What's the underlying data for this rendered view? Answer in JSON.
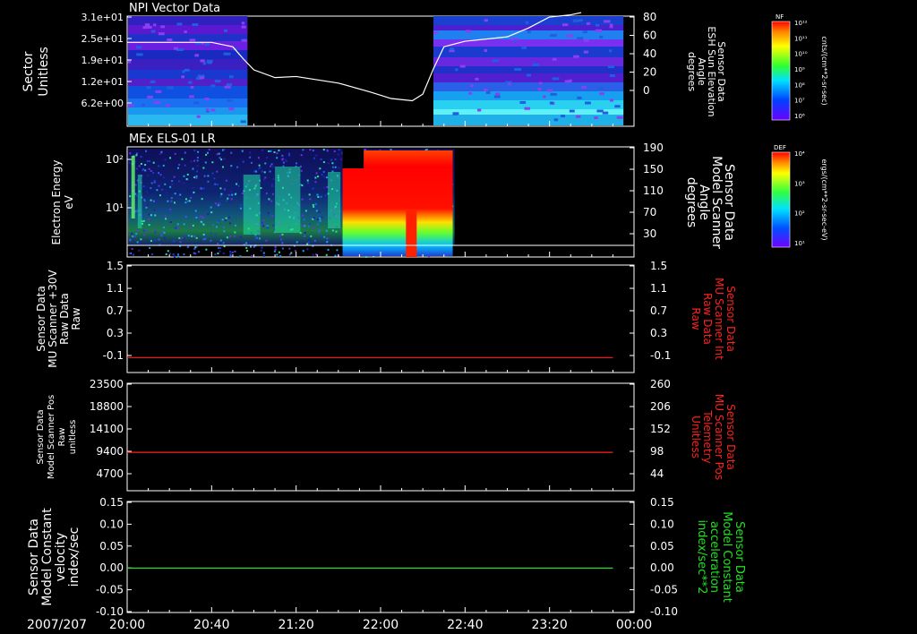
{
  "date_label": "2007/207",
  "colors": {
    "axis": "#ffffff",
    "red": "#ff2020",
    "green": "#20e020",
    "background": "#000000"
  },
  "chart_data": [
    {
      "type": "heatmap",
      "title": "NPI Vector Data",
      "ylabel_left": [
        "Sector",
        "Unitless"
      ],
      "yticks_left": [
        "3.1e+01",
        "2.5e+01",
        "1.9e+01",
        "1.2e+01",
        "6.2e+00"
      ],
      "ylabel_right": [
        "Sensor Data",
        "ESH Sun Elevation",
        "Angle",
        "degrees"
      ],
      "yticks_right": [
        "80",
        "60",
        "40",
        "20",
        "0"
      ],
      "ylim_right": [
        -20,
        80
      ],
      "colorbar": {
        "label": "NF",
        "unit": "cnts/(cm**2-sr-sec)",
        "ticks": [
          "10¹²",
          "10¹¹",
          "10¹⁰",
          "10⁹",
          "10⁸",
          "10⁷",
          "10⁶"
        ]
      },
      "data_gap": [
        "20:57",
        "22:25"
      ],
      "overlay_line": {
        "name": "ESH Sun Elevation Angle",
        "x": [
          "20:00",
          "20:40",
          "20:50",
          "20:55",
          "21:00",
          "21:10",
          "21:20",
          "21:40",
          "21:55",
          "22:05",
          "22:15",
          "22:20",
          "22:25",
          "22:30",
          "22:40",
          "22:50",
          "23:00",
          "23:10",
          "23:20",
          "23:30",
          "23:35"
        ],
        "y": [
          57,
          57,
          53,
          42,
          32,
          25,
          26,
          20,
          12,
          6,
          4,
          10,
          33,
          53,
          58,
          60,
          62,
          70,
          80,
          82,
          84
        ]
      }
    },
    {
      "type": "heatmap",
      "title": "MEx ELS-01 LR",
      "ylabel_left": [
        "Electron Energy",
        "eV"
      ],
      "yticks_left": [
        "10²",
        "10¹"
      ],
      "ylabel_right": [
        "Sensor Data",
        "Model Scanner",
        "Angle",
        "degrees"
      ],
      "yticks_right": [
        "190",
        "150",
        "110",
        "70",
        "30"
      ],
      "colorbar": {
        "label": "DEF",
        "unit": "ergs/(cm**2-sr-sec-eV)",
        "ticks": [
          "10⁴",
          "10³",
          "10²",
          "10¹"
        ]
      },
      "data_end": "22:35",
      "overlay_line": {
        "name": "Model Scanner Angle",
        "x": [
          "20:00",
          "23:55"
        ],
        "y": [
          10,
          10
        ]
      }
    },
    {
      "type": "line",
      "ylabel_left": [
        "Sensor Data",
        "MU Scanner +30V",
        "Raw Data",
        "Raw"
      ],
      "yticks_left": [
        "1.5",
        "1.1",
        "0.7",
        "0.3",
        "-0.1"
      ],
      "ylabel_right": [
        "Sensor Data",
        "MU Scanner Int",
        "Raw Data",
        "Raw"
      ],
      "yticks_right": [
        "1.5",
        "1.1",
        "0.7",
        "0.3",
        "-0.1"
      ],
      "ylim": [
        -0.3,
        1.5
      ],
      "series": [
        {
          "name": "MU Scanner Int Raw Data",
          "color": "#ff2020",
          "x": [
            "20:00",
            "23:50"
          ],
          "y": [
            -0.05,
            -0.05
          ]
        }
      ]
    },
    {
      "type": "line",
      "ylabel_left": [
        "Sensor Data",
        "Model Scanner Pos",
        "Raw",
        "unitless"
      ],
      "yticks_left": [
        "23500",
        "18800",
        "14100",
        "9400",
        "4700"
      ],
      "ylabel_right": [
        "Sensor Data",
        "MU Scanner Pos",
        "Telemetry",
        "Unitless"
      ],
      "yticks_right": [
        "260",
        "206",
        "152",
        "98",
        "44"
      ],
      "ylim": [
        0,
        23500
      ],
      "series": [
        {
          "name": "MU Scanner Pos Telemetry",
          "color": "#ff2020",
          "x": [
            "20:00",
            "23:50"
          ],
          "y": [
            8400,
            8400
          ]
        }
      ]
    },
    {
      "type": "line",
      "ylabel_left": [
        "Sensor Data",
        "Model Constant",
        "velocity",
        "index/sec"
      ],
      "yticks_left": [
        "0.15",
        "0.10",
        "0.05",
        "0.00",
        "-0.05",
        "-0.10"
      ],
      "ylabel_right": [
        "Sensor Data",
        "Model Constant",
        "acceleration",
        "index/sec**2"
      ],
      "yticks_right": [
        "0.15",
        "0.10",
        "0.05",
        "0.00",
        "-0.05",
        "-0.10"
      ],
      "ylim": [
        -0.1,
        0.15
      ],
      "series": [
        {
          "name": "Model Constant acceleration",
          "color": "#20e020",
          "x": [
            "20:00",
            "23:50"
          ],
          "y": [
            0.0,
            0.0
          ]
        }
      ]
    }
  ],
  "x_axis": {
    "ticks": [
      "20:00",
      "20:40",
      "21:20",
      "22:00",
      "22:40",
      "23:20",
      "00:00"
    ]
  }
}
